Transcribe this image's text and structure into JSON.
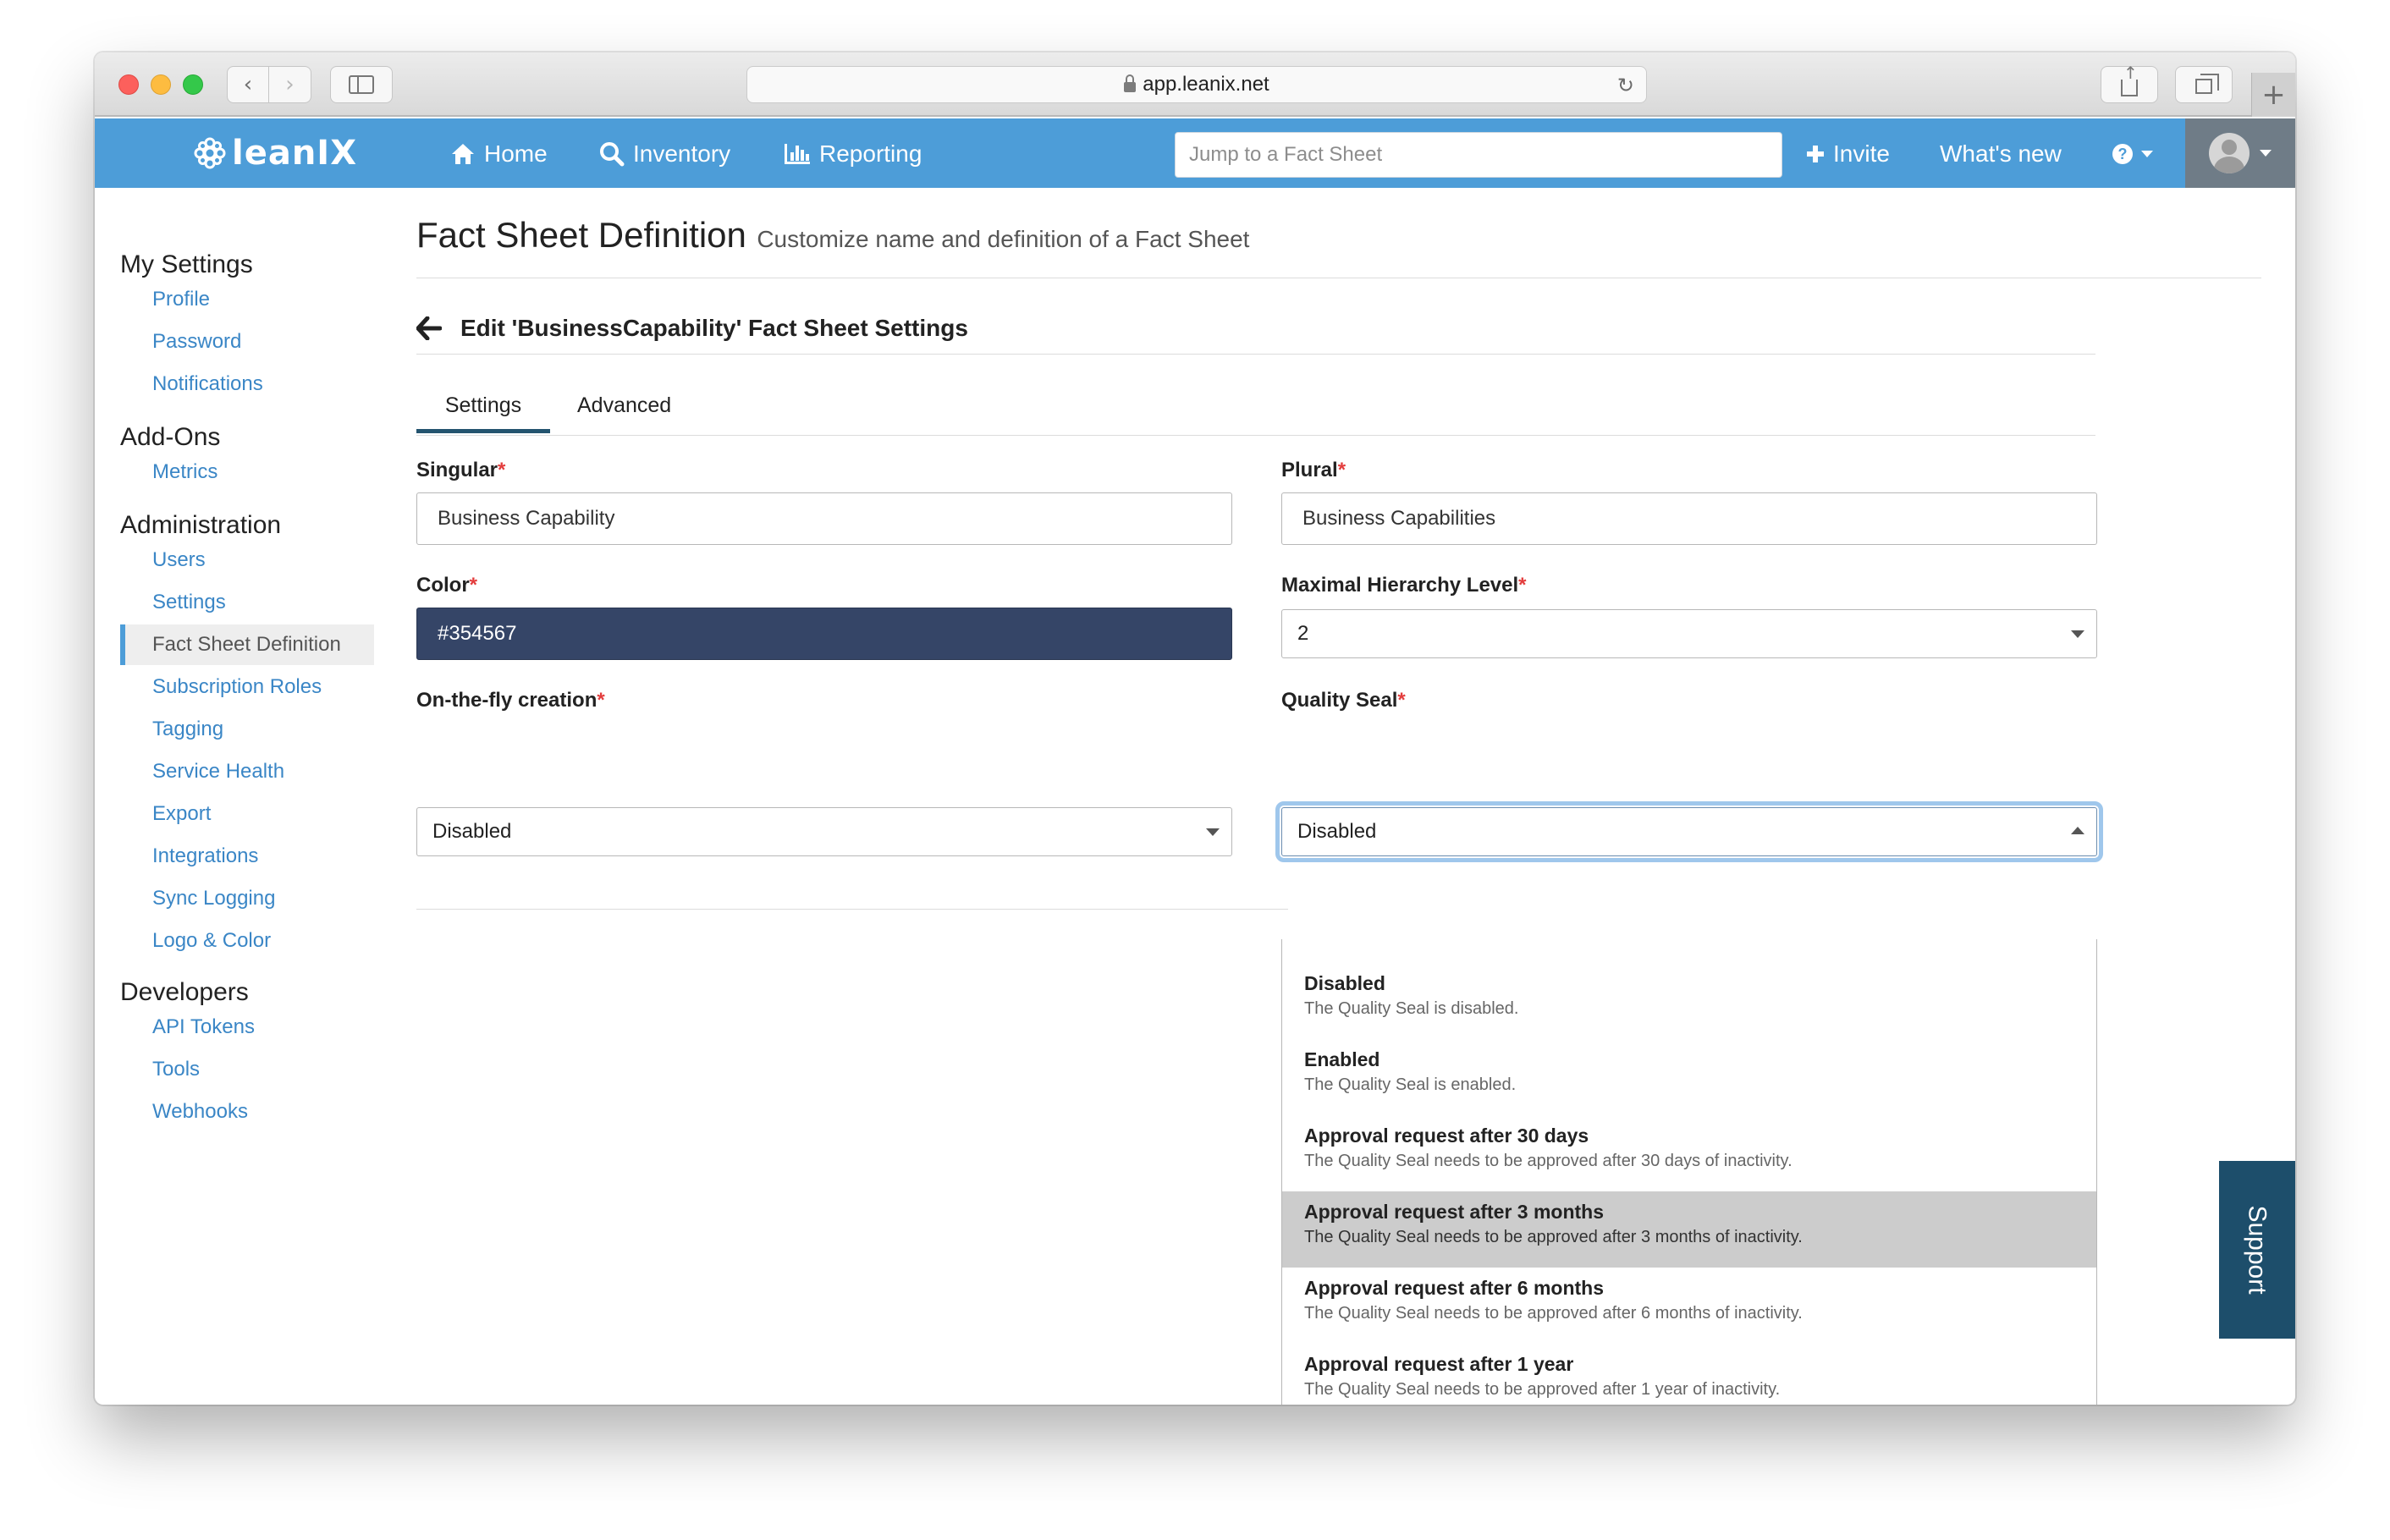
{
  "browser": {
    "url": "app.leanix.net"
  },
  "topnav": {
    "logo_text": "leanIX",
    "home": "Home",
    "inventory": "Inventory",
    "reporting": "Reporting",
    "jump_placeholder": "Jump to a Fact Sheet",
    "invite": "Invite",
    "whats_new": "What's new"
  },
  "sidebar": {
    "sections": [
      {
        "title": "My Settings",
        "items": [
          "Profile",
          "Password",
          "Notifications"
        ]
      },
      {
        "title": "Add-Ons",
        "items": [
          "Metrics"
        ]
      },
      {
        "title": "Administration",
        "items": [
          "Users",
          "Settings",
          "Fact Sheet Definition",
          "Subscription Roles",
          "Tagging",
          "Service Health",
          "Export",
          "Integrations",
          "Sync Logging",
          "Logo & Color"
        ]
      },
      {
        "title": "Developers",
        "items": [
          "API Tokens",
          "Tools",
          "Webhooks"
        ]
      }
    ],
    "active_item": "Fact Sheet Definition"
  },
  "page": {
    "title": "Fact Sheet Definition",
    "subtitle": "Customize name and definition of a Fact Sheet",
    "edit_title": "Edit 'BusinessCapability' Fact Sheet Settings",
    "tabs": [
      "Settings",
      "Advanced"
    ],
    "active_tab": "Settings"
  },
  "form": {
    "required_mark": "*",
    "singular": {
      "label": "Singular",
      "value": "Business Capability"
    },
    "plural": {
      "label": "Plural",
      "value": "Business Capabilities"
    },
    "color": {
      "label": "Color",
      "value": "#354567"
    },
    "max_hierarchy": {
      "label": "Maximal Hierarchy Level",
      "value": "2"
    },
    "on_the_fly": {
      "label": "On-the-fly creation",
      "value": "Disabled"
    },
    "quality_seal": {
      "label": "Quality Seal",
      "value": "Disabled"
    }
  },
  "quality_seal_options": [
    {
      "title": "Disabled",
      "desc": "The Quality Seal is disabled."
    },
    {
      "title": "Enabled",
      "desc": "The Quality Seal is enabled."
    },
    {
      "title": "Approval request after 30 days",
      "desc": "The Quality Seal needs to be approved after 30 days of inactivity."
    },
    {
      "title": "Approval request after 3 months",
      "desc": "The Quality Seal needs to be approved after 3 months of inactivity."
    },
    {
      "title": "Approval request after 6 months",
      "desc": "The Quality Seal needs to be approved after 6 months of inactivity."
    },
    {
      "title": "Approval request after 1 year",
      "desc": "The Quality Seal needs to be approved after 1 year of inactivity."
    }
  ],
  "highlighted_option": "Approval request after 3 months",
  "support_label": "Support",
  "colors": {
    "nav_bg": "#4d9dd8",
    "link": "#3a86c6",
    "color_swatch": "#354567",
    "support_bg": "#1d4e6b",
    "tab_underline": "#24546f",
    "required": "#e33d3d"
  }
}
